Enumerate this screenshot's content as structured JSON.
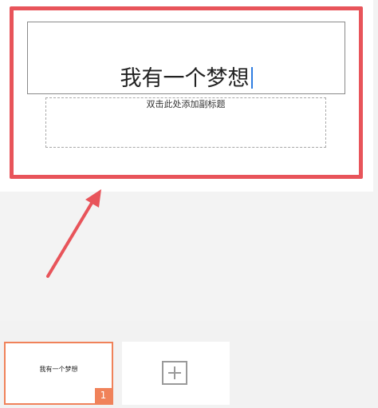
{
  "slide": {
    "title": "我有一个梦想",
    "subtitle_placeholder": "双击此处添加副标题"
  },
  "thumbnails": [
    {
      "title": "我有一个梦想",
      "number": "1"
    }
  ],
  "colors": {
    "highlight": "#e8545a",
    "selection_accent": "#f0825a",
    "caret": "#2f7de1"
  },
  "icons": {
    "add_slide": "plus-icon",
    "annotation": "arrow-icon"
  }
}
